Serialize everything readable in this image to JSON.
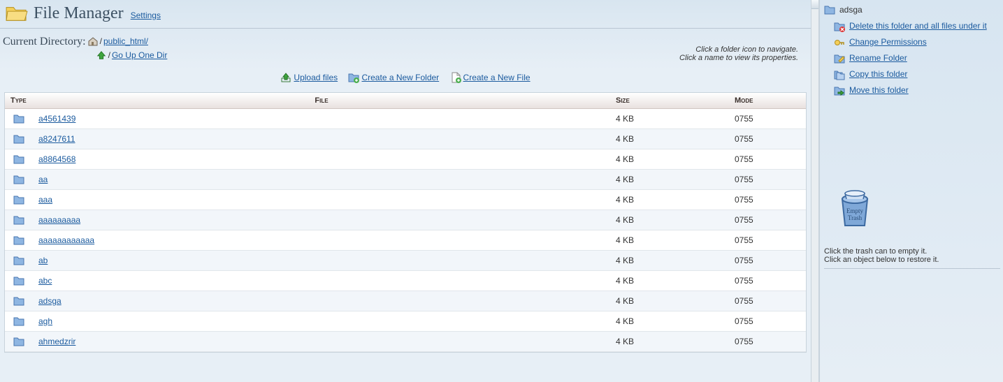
{
  "header": {
    "title": "File Manager",
    "settings_link": "Settings"
  },
  "curdir": {
    "label": "Current Directory:",
    "path_link": "public_html/",
    "up_link": "Go Up One Dir"
  },
  "hints": {
    "line1": "Click a folder icon to navigate.",
    "line2": "Click a name to view its properties."
  },
  "actions": {
    "upload": "Upload files",
    "new_folder": "Create a New Folder",
    "new_file": "Create a New File"
  },
  "columns": {
    "type": "Type",
    "file": "File",
    "size": "Size",
    "mode": "Mode"
  },
  "rows": [
    {
      "name": "a4561439",
      "size": "4 KB",
      "mode": "0755"
    },
    {
      "name": "a8247611",
      "size": "4 KB",
      "mode": "0755"
    },
    {
      "name": "a8864568",
      "size": "4 KB",
      "mode": "0755"
    },
    {
      "name": "aa",
      "size": "4 KB",
      "mode": "0755"
    },
    {
      "name": "aaa",
      "size": "4 KB",
      "mode": "0755"
    },
    {
      "name": "aaaaaaaaa",
      "size": "4 KB",
      "mode": "0755"
    },
    {
      "name": "aaaaaaaaaaaa",
      "size": "4 KB",
      "mode": "0755"
    },
    {
      "name": "ab",
      "size": "4 KB",
      "mode": "0755"
    },
    {
      "name": "abc",
      "size": "4 KB",
      "mode": "0755"
    },
    {
      "name": "adsga",
      "size": "4 KB",
      "mode": "0755"
    },
    {
      "name": "agh",
      "size": "4 KB",
      "mode": "0755"
    },
    {
      "name": "ahmedzrir",
      "size": "4 KB",
      "mode": "0755"
    }
  ],
  "side": {
    "folder_name": "adsga",
    "delete": "Delete this folder and all files under it",
    "perms": "Change Permissions",
    "rename": "Rename Folder",
    "copy": "Copy this folder",
    "move": "Move this folder",
    "trash_help1": "Click the trash can to empty it.",
    "trash_help2": "Click an object below to restore it."
  }
}
